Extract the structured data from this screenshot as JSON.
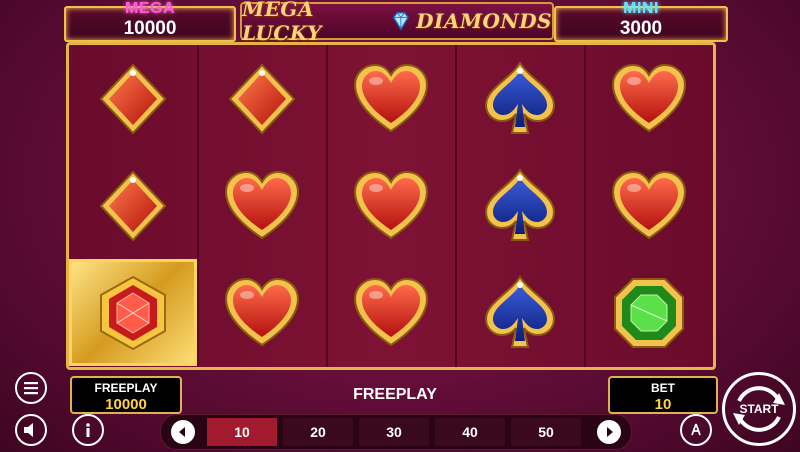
{
  "jackpots": {
    "mega": {
      "label": "MEGA",
      "value": "10000"
    },
    "mini": {
      "label": "MINI",
      "value": "3000"
    }
  },
  "logo": {
    "text_left": "MEGA LUCKY",
    "text_right": "DIAMONDS",
    "gem_icon": "diamond-icon"
  },
  "reels": [
    [
      "diamond",
      "diamond",
      "red-gem"
    ],
    [
      "diamond",
      "heart",
      "heart"
    ],
    [
      "heart",
      "heart",
      "heart"
    ],
    [
      "spade",
      "spade",
      "spade"
    ],
    [
      "heart",
      "heart",
      "green-gem"
    ]
  ],
  "winning_cell": {
    "reel": 1,
    "row": 3
  },
  "freeplay_box": {
    "label": "FREEPLAY",
    "value": "10000"
  },
  "mode_label": "FREEPLAY",
  "bet_box": {
    "label": "BET",
    "value": "10"
  },
  "bet_options": [
    "10",
    "20",
    "30",
    "40",
    "50"
  ],
  "selected_bet": "10",
  "start_label": "START",
  "icons": {
    "menu": "hamburger-icon",
    "sound": "speaker-icon",
    "info": "info-icon",
    "auto": "autoplay-icon"
  },
  "colors": {
    "frame_gold": "#e6b54a",
    "mega_pink": "#ff5bd6",
    "mini_cyan": "#5ee8ff",
    "bet_value": "#ffd24a"
  }
}
